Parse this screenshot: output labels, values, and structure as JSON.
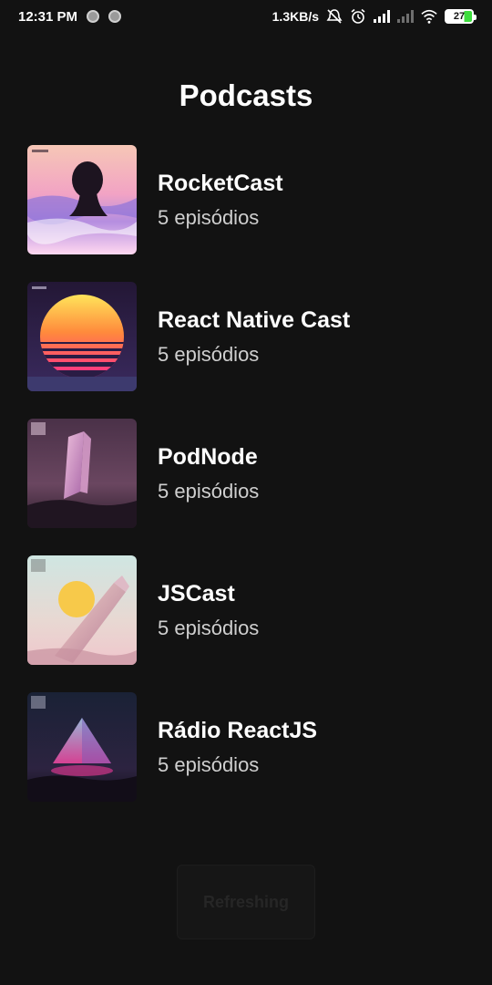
{
  "status_bar": {
    "time": "12:31 PM",
    "network_speed": "1.3KB/s",
    "battery": "27",
    "icons": [
      "notification-dot-icon",
      "notification-dot-icon",
      "alarm-off-icon",
      "alarm-icon",
      "signal-icon",
      "signal-weak-icon",
      "wifi-icon",
      "battery-icon"
    ]
  },
  "header": {
    "title": "Podcasts"
  },
  "podcasts": [
    {
      "title": "RocketCast",
      "episodes": "5 episódios"
    },
    {
      "title": "React Native Cast",
      "episodes": "5 episódios"
    },
    {
      "title": "PodNode",
      "episodes": "5 episódios"
    },
    {
      "title": "JSCast",
      "episodes": "5 episódios"
    },
    {
      "title": "Rádio ReactJS",
      "episodes": "5 episódios"
    }
  ],
  "floating_button": {
    "label": "Refreshing"
  },
  "colors": {
    "background": "#121212",
    "text": "#ffffff",
    "subtext": "#cfcfcf",
    "battery_accent": "#3ddc3d"
  }
}
